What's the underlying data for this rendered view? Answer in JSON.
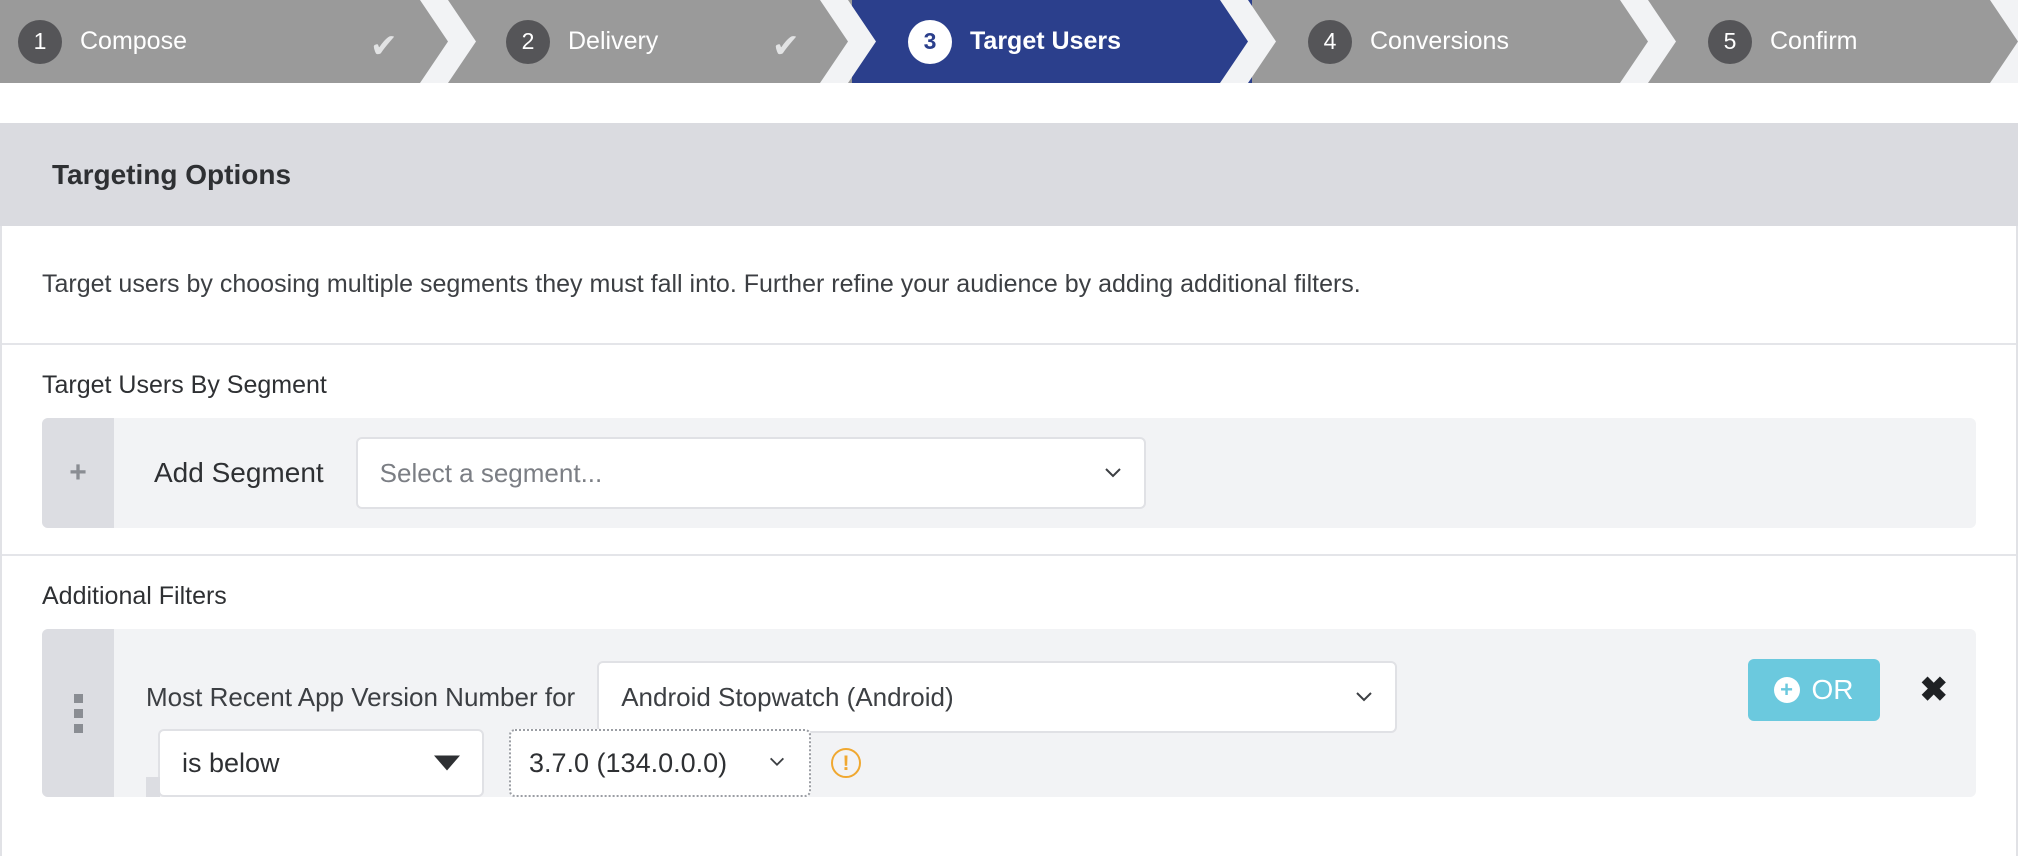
{
  "stepper": {
    "steps": [
      {
        "num": "1",
        "label": "Compose",
        "state": "complete",
        "check": "✔"
      },
      {
        "num": "2",
        "label": "Delivery",
        "state": "complete",
        "check": "✔"
      },
      {
        "num": "3",
        "label": "Target Users",
        "state": "active",
        "check": ""
      },
      {
        "num": "4",
        "label": "Conversions",
        "state": "upcoming",
        "check": ""
      },
      {
        "num": "5",
        "label": "Confirm",
        "state": "upcoming",
        "check": ""
      }
    ],
    "active_color": "#2b3f8c",
    "inactive_color": "#9a9a9a",
    "num_bubble_color": "#555558"
  },
  "panel": {
    "title": "Targeting Options",
    "intro": "Target users by choosing multiple segments they must fall into. Further refine your audience by adding additional filters."
  },
  "segments": {
    "section_title": "Target Users By Segment",
    "add_label": "Add Segment",
    "add_icon": "+",
    "select_placeholder": "Select a segment...",
    "select_chevron": "chevron-down-icon"
  },
  "filters": {
    "section_title": "Additional Filters",
    "rows": [
      {
        "drag_handle": "drag-handle-icon",
        "label": "Most Recent App Version Number for",
        "app_value": "Android Stopwatch (Android)",
        "operator_value": "is below",
        "version_value": "3.7.0 (134.0.0.0)",
        "warning_icon": "!",
        "or_button_label": "OR",
        "or_button_icon": "+",
        "or_button_color": "#6bc9de",
        "remove_icon": "✖"
      }
    ]
  }
}
